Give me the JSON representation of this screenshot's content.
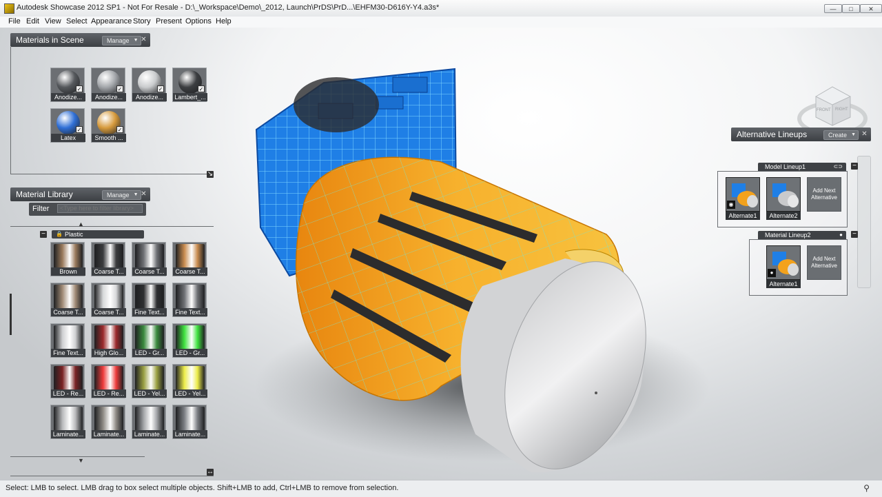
{
  "window": {
    "title": "Autodesk Showcase 2012 SP1 - Not For Resale - D:\\_Workspace\\Demo\\_2012, Launch\\PrDS\\PrD...\\EHFM30-D616Y-Y4.a3s*",
    "minimize_glyph": "—",
    "maximize_glyph": "□",
    "close_glyph": "✕"
  },
  "menu": {
    "items": [
      "File",
      "Edit",
      "View",
      "Select",
      "Appearance",
      "Story",
      "Present",
      "Options",
      "Help"
    ]
  },
  "materials_in_scene": {
    "title": "Materials in Scene",
    "manage_label": "Manage",
    "close_glyph": "✕",
    "items": [
      {
        "label": "Anodize...",
        "color": "#55585c"
      },
      {
        "label": "Anodize...",
        "color": "#a3a6aa"
      },
      {
        "label": "Anodize...",
        "color": "#c9cbcd"
      },
      {
        "label": "Lambert_...",
        "color": "#3c3e41"
      },
      {
        "label": "Latex",
        "color": "#2f6fd6"
      },
      {
        "label": "Smooth ...",
        "color": "#d69a3c"
      }
    ]
  },
  "material_library": {
    "title": "Material Library",
    "manage_label": "Manage",
    "close_glyph": "✕",
    "filter_label": "Filter",
    "filter_placeholder": "<Type here to filter library>",
    "group_name": "Plastic",
    "items": [
      {
        "label": "Brown",
        "color": "#9a7a5c"
      },
      {
        "label": "Coarse T...",
        "color": "#3b3c3e"
      },
      {
        "label": "Coarse T...",
        "color": "#6f7175"
      },
      {
        "label": "Coarse T...",
        "color": "#c98c4f"
      },
      {
        "label": "Coarse T...",
        "color": "#a08a75"
      },
      {
        "label": "Coarse T...",
        "color": "#d7d8da"
      },
      {
        "label": "Fine Text...",
        "color": "#2e2f31"
      },
      {
        "label": "Fine Text...",
        "color": "#6e7074"
      },
      {
        "label": "Fine Text...",
        "color": "#cfd0d2"
      },
      {
        "label": "High Glo...",
        "color": "#9c2a2c"
      },
      {
        "label": "LED - Gr...",
        "color": "#3a8a3e"
      },
      {
        "label": "LED - Gr...",
        "color": "#3fe23f"
      },
      {
        "label": "LED - Re...",
        "color": "#7a2224"
      },
      {
        "label": "LED - Re...",
        "color": "#ee3b3b"
      },
      {
        "label": "LED - Yel...",
        "color": "#9aa042"
      },
      {
        "label": "LED - Yel...",
        "color": "#ecec4a"
      },
      {
        "label": "Laminate...",
        "color": "#b9babc"
      },
      {
        "label": "Laminate...",
        "color": "#8e8a84"
      },
      {
        "label": "Laminate...",
        "color": "#a4a6a9"
      },
      {
        "label": "Laminate...",
        "color": "#7c7f84"
      }
    ]
  },
  "alternative_lineups": {
    "title": "Alternative Lineups",
    "create_label": "Create",
    "close_glyph": "✕",
    "lineups": [
      {
        "name": "Model Lineup1",
        "alternates": [
          "Alternate1",
          "Alternate2"
        ],
        "add_next_label": "Add Next Alternative"
      },
      {
        "name": "Material Lineup2",
        "alternates": [
          "Alternate1"
        ],
        "add_next_label": "Add Next Alternative"
      }
    ]
  },
  "viewcube": {
    "front_label": "FRONT",
    "right_label": "RIGHT"
  },
  "statusbar": {
    "message": "Select: LMB to select. LMB drag to box select multiple objects. Shift+LMB to add, Ctrl+LMB to remove from selection."
  },
  "colors": {
    "part_blue": "#1f7fe6",
    "part_orange": "#f3a21c",
    "part_silver": "#d9dadb"
  }
}
